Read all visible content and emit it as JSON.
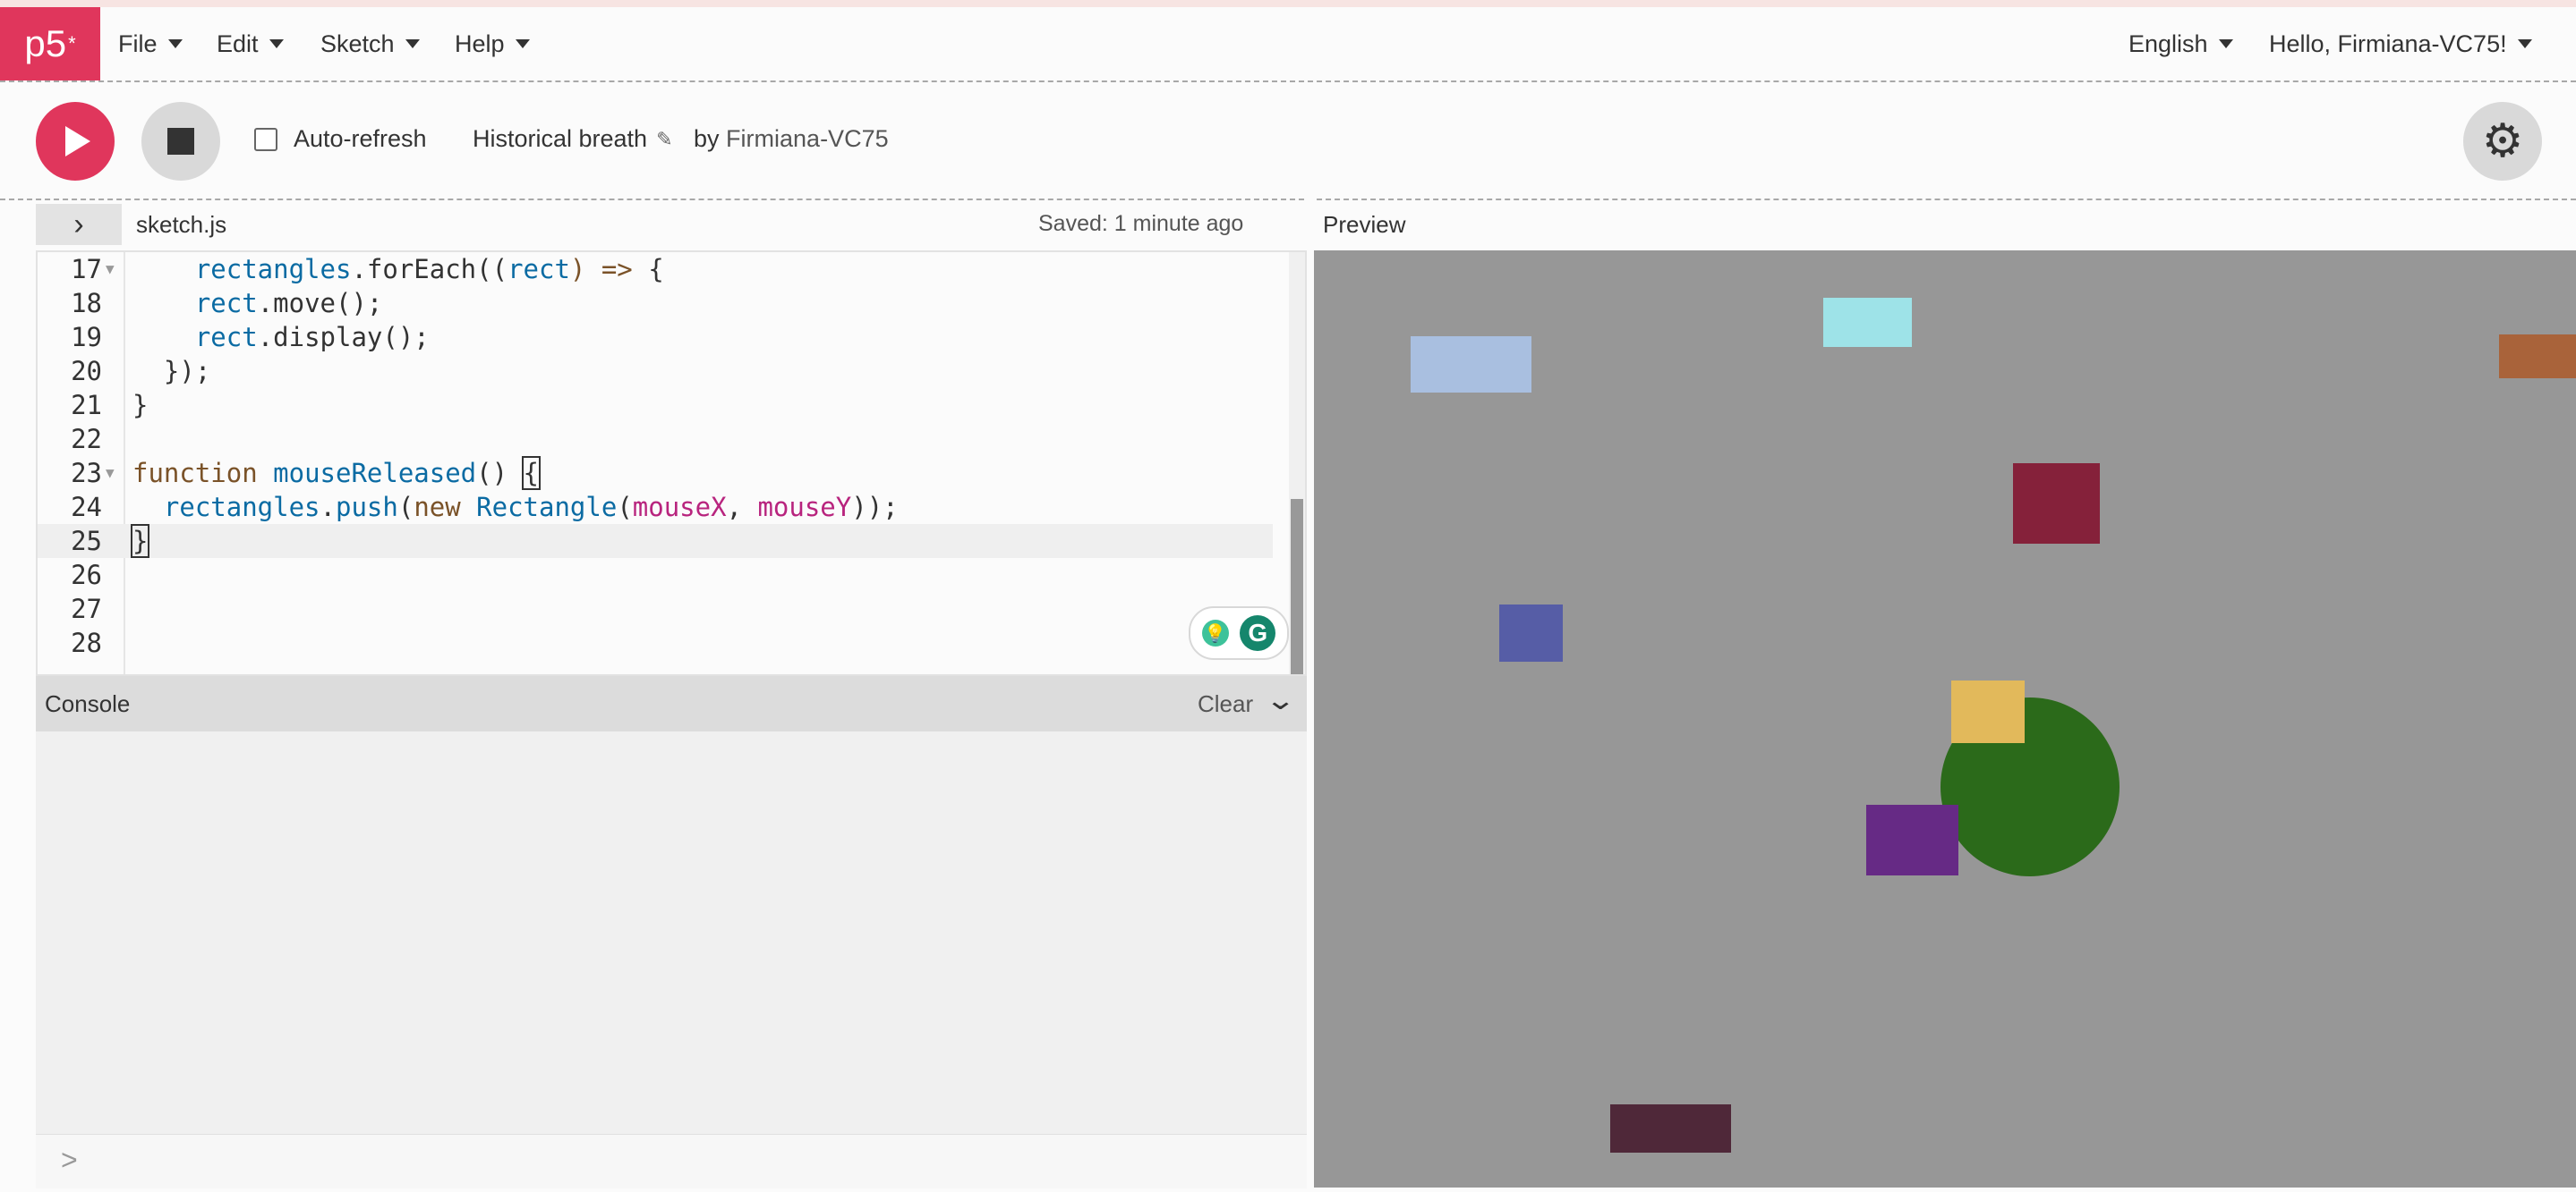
{
  "nav": {
    "logo": "p5",
    "logo_sup": "*",
    "menus": [
      "File",
      "Edit",
      "Sketch",
      "Help"
    ],
    "language": "English",
    "user_greeting": "Hello, Firmiana-VC75!"
  },
  "toolbar": {
    "auto_refresh_label": "Auto-refresh",
    "auto_refresh_checked": false,
    "sketch_name": "Historical breath",
    "by_label": "by",
    "owner": "Firmiana-VC75"
  },
  "editor": {
    "file_name": "sketch.js",
    "saved_status": "Saved: 1 minute ago",
    "active_line": "25",
    "lines": [
      {
        "n": "17",
        "fold": true
      },
      {
        "n": "18"
      },
      {
        "n": "19"
      },
      {
        "n": "20"
      },
      {
        "n": "21"
      },
      {
        "n": "22"
      },
      {
        "n": "23",
        "fold": true
      },
      {
        "n": "24"
      },
      {
        "n": "25"
      },
      {
        "n": "26"
      },
      {
        "n": "27"
      },
      {
        "n": "28"
      }
    ],
    "code": {
      "l17_indent": "    ",
      "l17_var": "rectangles",
      "l17_call": ".forEach((",
      "l17_arg": "rect",
      "l17_arrow": ") => ",
      "l17_brace": "{",
      "l18_var": "rect",
      "l18_rest": ".move();",
      "l19_var": "rect",
      "l19_rest": ".display();",
      "l20": "  });",
      "l21": "}",
      "l23_kw": "function",
      "l23_name": "mouseReleased",
      "l23_paren": "() ",
      "l23_brace": "{",
      "l24_var": "rectangles",
      "l24_dot": ".",
      "l24_push": "push",
      "l24_open": "(",
      "l24_new": "new",
      "l24_cls": "Rectangle",
      "l24_open2": "(",
      "l24_mx": "mouseX",
      "l24_comma": ", ",
      "l24_my": "mouseY",
      "l24_close": "));",
      "l25": "}"
    }
  },
  "console": {
    "title": "Console",
    "clear_label": "Clear",
    "prompt": ">"
  },
  "preview": {
    "label": "Preview",
    "background": "#979797",
    "shapes": [
      {
        "name": "rect-light-blue",
        "color": "#a9bfe0"
      },
      {
        "name": "rect-cyan",
        "color": "#9ee3e8"
      },
      {
        "name": "rect-orange",
        "color": "#a9633a"
      },
      {
        "name": "rect-maroon",
        "color": "#85213a"
      },
      {
        "name": "rect-indigo",
        "color": "#565da6"
      },
      {
        "name": "circle-green",
        "color": "#2b6a1a"
      },
      {
        "name": "rect-gold",
        "color": "#e2b95b"
      },
      {
        "name": "rect-purple",
        "color": "#662a85"
      },
      {
        "name": "rect-plum",
        "color": "#4f2839"
      }
    ]
  },
  "colors": {
    "accent": "#e0365c",
    "keyword": "#7a5228",
    "identifier": "#0b6ba3",
    "argument": "#b8247e"
  }
}
